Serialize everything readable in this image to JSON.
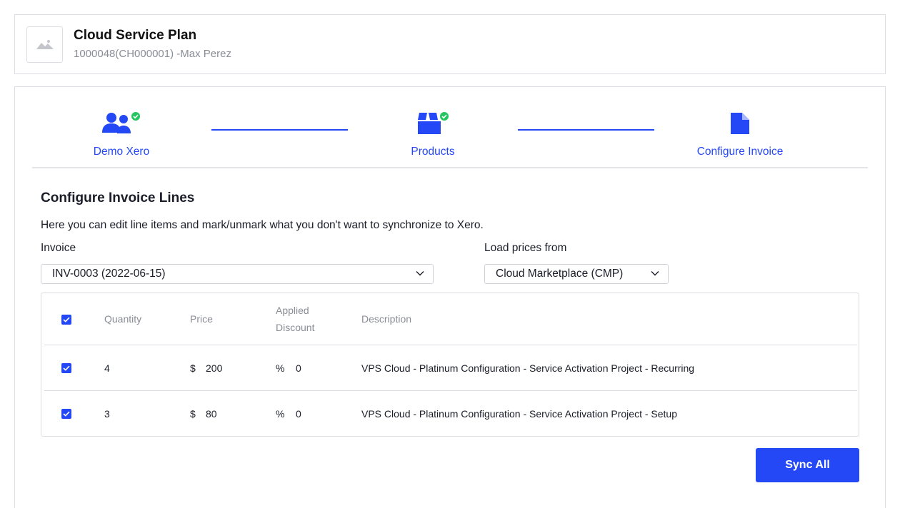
{
  "header": {
    "title": "Cloud Service Plan",
    "subtitle": "1000048(CH000001) -Max Perez",
    "avatar_icon": "image-placeholder-icon"
  },
  "stepper": {
    "steps": [
      {
        "label": "Demo Xero",
        "icon": "users-icon",
        "completed": true
      },
      {
        "label": "Products",
        "icon": "box-icon",
        "completed": true
      },
      {
        "label": "Configure Invoice",
        "icon": "document-icon",
        "completed": false
      }
    ],
    "accent_color": "#2448f5",
    "check_color": "#22c55e"
  },
  "section": {
    "title": "Configure Invoice Lines",
    "description": "Here you can edit line items and mark/unmark what you don't want to synchronize to Xero."
  },
  "invoice_select": {
    "label": "Invoice",
    "value": "INV-0003 (2022-06-15)"
  },
  "prices_select": {
    "label": "Load prices from",
    "value": "Cloud Marketplace (CMP)"
  },
  "table": {
    "header_checked": true,
    "columns": {
      "quantity": "Quantity",
      "price": "Price",
      "discount_line1": "Applied",
      "discount_line2": "Discount",
      "description": "Description"
    },
    "rows": [
      {
        "checked": true,
        "quantity": "4",
        "currency": "$",
        "price": "200",
        "discount_unit": "%",
        "discount": "0",
        "description": "VPS Cloud - Platinum Configuration - Service Activation Project - Recurring"
      },
      {
        "checked": true,
        "quantity": "3",
        "currency": "$",
        "price": "80",
        "discount_unit": "%",
        "discount": "0",
        "description": "VPS Cloud - Platinum Configuration - Service Activation Project - Setup"
      }
    ]
  },
  "actions": {
    "sync_label": "Sync All"
  }
}
